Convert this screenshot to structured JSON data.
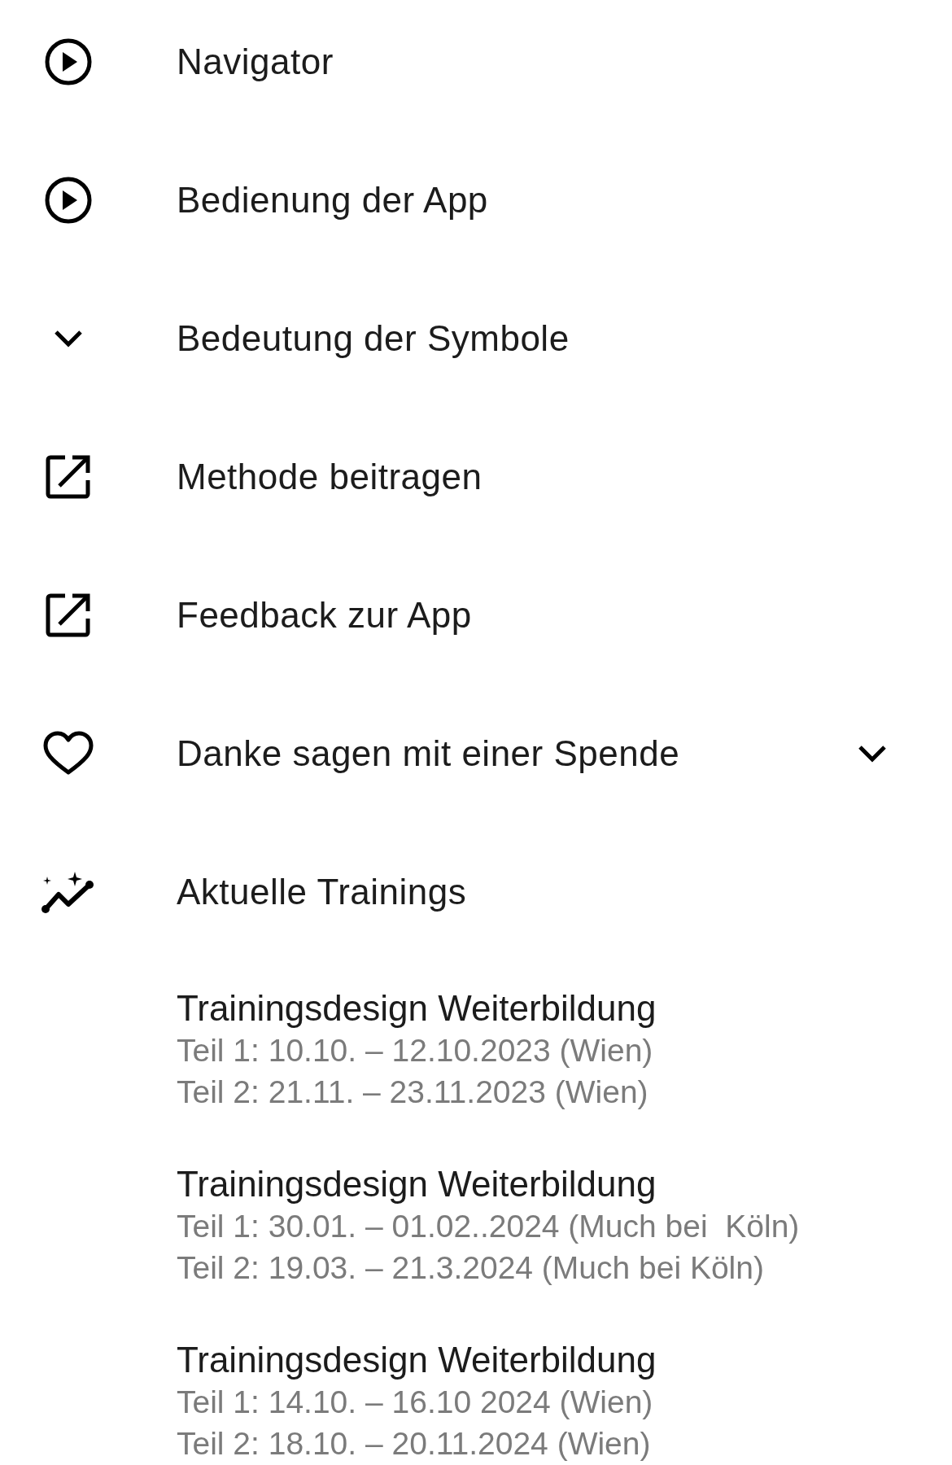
{
  "menu_items": [
    {
      "kind": "video",
      "label": "Navigator"
    },
    {
      "kind": "video",
      "label": "Bedienung der App"
    },
    {
      "kind": "section",
      "label": "Bedeutung der Symbole"
    },
    {
      "kind": "external",
      "label": "Methode beitragen"
    },
    {
      "kind": "external",
      "label": "Feedback zur App"
    },
    {
      "kind": "donate",
      "label": "Danke sagen mit einer Spende",
      "expanded": false
    },
    {
      "kind": "trainings",
      "label": "Aktuelle Trainings"
    }
  ],
  "trainings": [
    {
      "title": "Trainingsdesign Weiterbildung",
      "lines": [
        "Teil 1: 10.10. – 12.10.2023 (Wien)",
        "Teil 2: 21.11. – 23.11.2023 (Wien)"
      ]
    },
    {
      "title": "Trainingsdesign Weiterbildung",
      "lines": [
        "Teil 1: 30.01. – 01.02..2024 (Much bei  Köln)",
        "Teil 2: 19.03. – 21.3.2024 (Much bei Köln)"
      ]
    },
    {
      "title": "Trainingsdesign Weiterbildung",
      "lines": [
        "Teil 1: 14.10. – 16.10 2024 (Wien)",
        "Teil 2: 18.10. – 20.11.2024 (Wien)"
      ]
    }
  ]
}
